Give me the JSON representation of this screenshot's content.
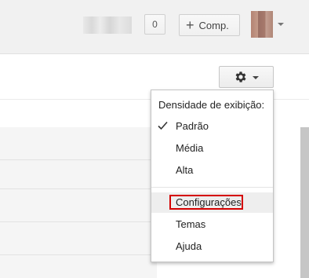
{
  "header": {
    "notifications_count": "0",
    "share_button": {
      "icon": "plus-icon",
      "label": "Comp."
    }
  },
  "settings_menu": {
    "title": "Densidade de exibição:",
    "density_options": [
      {
        "label": "Padrão",
        "checked": true
      },
      {
        "label": "Média",
        "checked": false
      },
      {
        "label": "Alta",
        "checked": false
      }
    ],
    "actions": [
      {
        "label": "Configurações",
        "highlighted": true
      },
      {
        "label": "Temas"
      },
      {
        "label": "Ajuda"
      }
    ]
  },
  "colors": {
    "highlight_border": "#d40000",
    "hover_background": "#eeeeee"
  }
}
